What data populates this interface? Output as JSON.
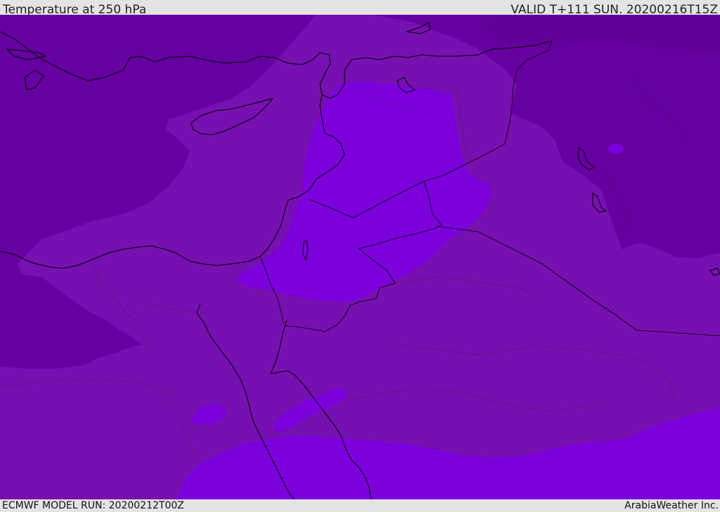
{
  "header": {
    "title": "Temperature at 250 hPa",
    "valid": "VALID T+111 SUN. 20200216T15Z"
  },
  "footer": {
    "model_run": "ECMWF MODEL RUN: 20200212T00Z",
    "credit": "ArabiaWeather Inc."
  },
  "map": {
    "colors": {
      "dark": "#6700a0",
      "mid": "#7710b0",
      "bright": "#7c00dc",
      "coast": "#000000"
    }
  }
}
